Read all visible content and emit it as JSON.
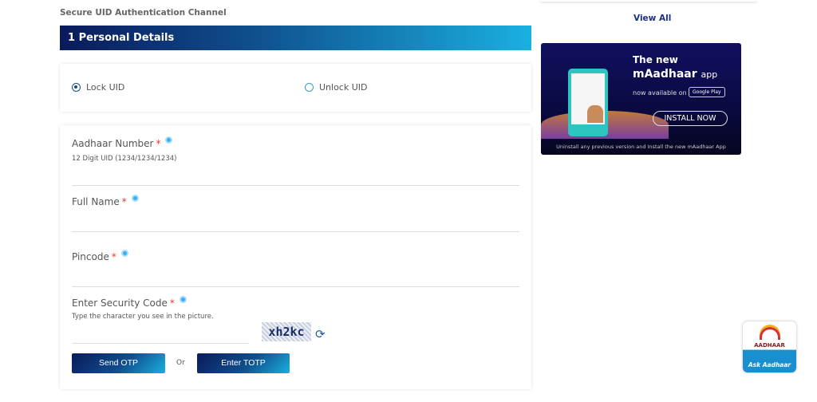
{
  "breadcrumb": "Secure UID Authentication Channel",
  "section_title": "1 Personal Details",
  "radios": [
    {
      "label": "Lock UID",
      "selected": true
    },
    {
      "label": "Unlock UID",
      "selected": false
    }
  ],
  "fields": {
    "aadhaar": {
      "label": "Aadhaar Number",
      "required": "*",
      "hint": "12 Digit UID (1234/1234/1234)",
      "value": ""
    },
    "name": {
      "label": "Full Name",
      "required": "*",
      "value": ""
    },
    "pincode": {
      "label": "Pincode",
      "required": "*",
      "value": ""
    },
    "security": {
      "label": "Enter Security Code",
      "required": "*",
      "hint": "Type the character you see in the picture.",
      "value": "",
      "captcha": "xh2kc"
    }
  },
  "buttons": {
    "send_otp": "Send OTP",
    "or": "Or",
    "enter_totp": "Enter TOTP"
  },
  "sidebar": {
    "view_all": "View All",
    "banner": {
      "line1": "The new",
      "app_name": "mAadhaar",
      "app_suffix": "app",
      "available": "now available on",
      "store": "Google Play",
      "install": "INSTALL NOW",
      "footer": "Uninstall any previous version and Install the new mAadhaar App"
    },
    "ask": {
      "logo_text": "AADHAAR",
      "label": "Ask Aadhaar"
    }
  },
  "colors": {
    "header_start": "#0a1a5c",
    "header_end": "#1ab0e0",
    "required": "#ee3333",
    "link": "#1a2f8a"
  }
}
